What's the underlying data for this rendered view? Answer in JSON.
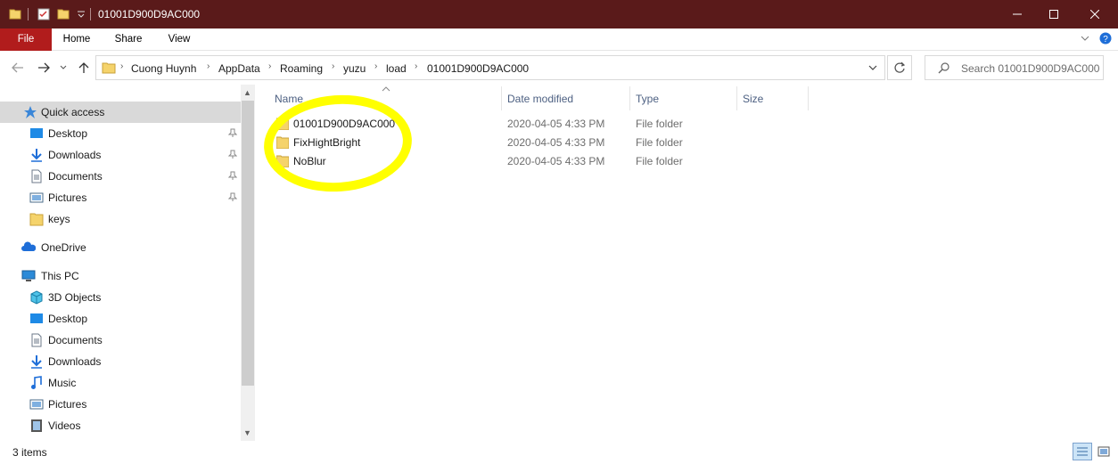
{
  "window": {
    "title": "01001D900D9AC000"
  },
  "ribbon": {
    "tabs": [
      "File",
      "Home",
      "Share",
      "View"
    ]
  },
  "address": {
    "crumbs": [
      "Cuong Huynh",
      "AppData",
      "Roaming",
      "yuzu",
      "load",
      "01001D900D9AC000"
    ]
  },
  "search": {
    "placeholder": "Search 01001D900D9AC000"
  },
  "navpane": {
    "quick_access": "Quick access",
    "quick_items": [
      {
        "label": "Desktop",
        "icon": "desktop-icon",
        "pinned": true
      },
      {
        "label": "Downloads",
        "icon": "downloads-icon",
        "pinned": true
      },
      {
        "label": "Documents",
        "icon": "documents-icon",
        "pinned": true
      },
      {
        "label": "Pictures",
        "icon": "pictures-icon",
        "pinned": true
      },
      {
        "label": "keys",
        "icon": "folder-icon",
        "pinned": false
      }
    ],
    "onedrive": "OneDrive",
    "this_pc": "This PC",
    "pc_items": [
      {
        "label": "3D Objects",
        "icon": "3d-objects-icon"
      },
      {
        "label": "Desktop",
        "icon": "desktop-icon"
      },
      {
        "label": "Documents",
        "icon": "documents-icon"
      },
      {
        "label": "Downloads",
        "icon": "downloads-icon"
      },
      {
        "label": "Music",
        "icon": "music-icon"
      },
      {
        "label": "Pictures",
        "icon": "pictures-icon"
      },
      {
        "label": "Videos",
        "icon": "videos-icon"
      }
    ]
  },
  "columns": {
    "name": "Name",
    "date": "Date modified",
    "type": "Type",
    "size": "Size"
  },
  "files": [
    {
      "name": "01001D900D9AC000",
      "date": "2020-04-05 4:33 PM",
      "type": "File folder"
    },
    {
      "name": "FixHightBright",
      "date": "2020-04-05 4:33 PM",
      "type": "File folder"
    },
    {
      "name": "NoBlur",
      "date": "2020-04-05 4:33 PM",
      "type": "File folder"
    }
  ],
  "status": {
    "items": "3 items"
  },
  "colors": {
    "titlebar": "#5a1a1a",
    "file_tab": "#b11c1c",
    "highlight": "#ffff00",
    "folder": "#f5d36b"
  }
}
